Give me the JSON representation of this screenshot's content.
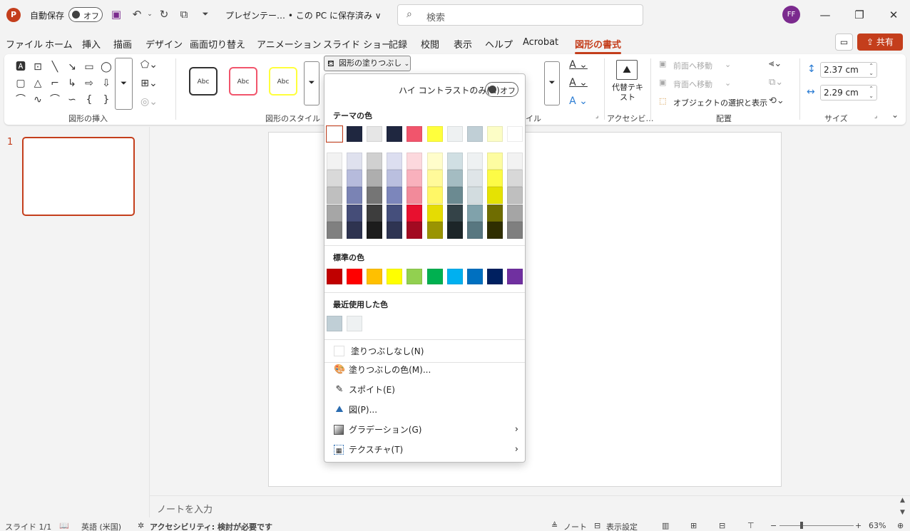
{
  "titlebar": {
    "app_logo": "P",
    "autosave_label": "自動保存",
    "autosave_toggle": "オフ",
    "doc_title": "プレゼンテー…  • この PC に保存済み ∨",
    "search_placeholder": "検索",
    "avatar_initials": "FF"
  },
  "tabs": [
    "ファイル",
    "ホーム",
    "挿入",
    "描画",
    "デザイン",
    "画面切り替え",
    "アニメーション",
    "スライド ショー",
    "記録",
    "校閲",
    "表示",
    "ヘルプ",
    "Acrobat",
    "図形の書式"
  ],
  "share_label": "共有",
  "ribbon": {
    "insert_shapes_label": "図形の挿入",
    "shape_styles_label": "図形のスタイル",
    "style_sample": "Abc",
    "fill_button": "図形の塗りつぶし",
    "wordart_label": "イル",
    "alt_text_label": "代替テキスト",
    "access_label": "アクセシビ…",
    "bring_forward": "前面へ移動",
    "send_backward": "背面へ移動",
    "selection_pane": "オブジェクトの選択と表示",
    "arrange_label": "配置",
    "height_value": "2.37 cm",
    "width_value": "2.29 cm",
    "size_label": "サイズ"
  },
  "slides_pane": {
    "slide_number": "1"
  },
  "notes_placeholder": "ノートを入力",
  "status": {
    "slide_info": "スライド 1/1",
    "language": "英語 (米国)",
    "accessibility": "アクセシビリティ: 検討が必要です",
    "notes": "ノート",
    "display_settings": "表示設定",
    "zoom": "63%"
  },
  "fill_dropdown": {
    "high_contrast_label": "ハイ コントラストのみ(H)",
    "high_contrast_toggle": "オフ",
    "theme_colors_heading": "テーマの色",
    "theme_colors": [
      "#ffffff",
      "#1f2740",
      "#e6e6e6",
      "#1f2740",
      "#f1556c",
      "#ffff3c",
      "#eef1f2",
      "#c0cfd6",
      "#fcfdc6",
      "#ffffff"
    ],
    "theme_shades": [
      [
        "#f2f2f2",
        "#dfe1ee",
        "#d0d0d0",
        "#dcdef0",
        "#fcd8dd",
        "#fffdcb",
        "#d0dfe3",
        "#eef1f2",
        "#fdfca1",
        "#f2f2f2"
      ],
      [
        "#d9d9d9",
        "#b6bbdc",
        "#aeaeae",
        "#babfdf",
        "#f9b1bd",
        "#fffa9a",
        "#a4bcc2",
        "#dfe5e8",
        "#fdfb46",
        "#d8d8d8"
      ],
      [
        "#bfbfbf",
        "#7a83b4",
        "#757575",
        "#7c86bb",
        "#f28a9a",
        "#fff766",
        "#6b8a91",
        "#d2dcdf",
        "#e5e203",
        "#bfbfbf"
      ],
      [
        "#a6a6a6",
        "#454d78",
        "#3d3d3d",
        "#454f7c",
        "#e8102f",
        "#e5dc03",
        "#344348",
        "#80a2ab",
        "#6f6d01",
        "#a5a5a5"
      ],
      [
        "#808080",
        "#2e3350",
        "#1c1c1c",
        "#2e3452",
        "#a20a21",
        "#9a9402",
        "#1c2528",
        "#587780",
        "#2f2e01",
        "#7f7f7f"
      ]
    ],
    "standard_colors_heading": "標準の色",
    "standard_colors": [
      "#c00000",
      "#ff0000",
      "#ffc000",
      "#ffff00",
      "#92d050",
      "#00b050",
      "#00b0f0",
      "#0070c0",
      "#002060",
      "#7030a0"
    ],
    "recent_colors_heading": "最近使用した色",
    "recent_colors": [
      "#c0cfd6",
      "#eef1f2"
    ],
    "no_fill": "塗りつぶしなし(N)",
    "more_colors": "塗りつぶしの色(M)...",
    "eyedropper": "スポイト(E)",
    "picture": "図(P)...",
    "gradient": "グラデーション(G)",
    "texture": "テクスチャ(T)"
  }
}
